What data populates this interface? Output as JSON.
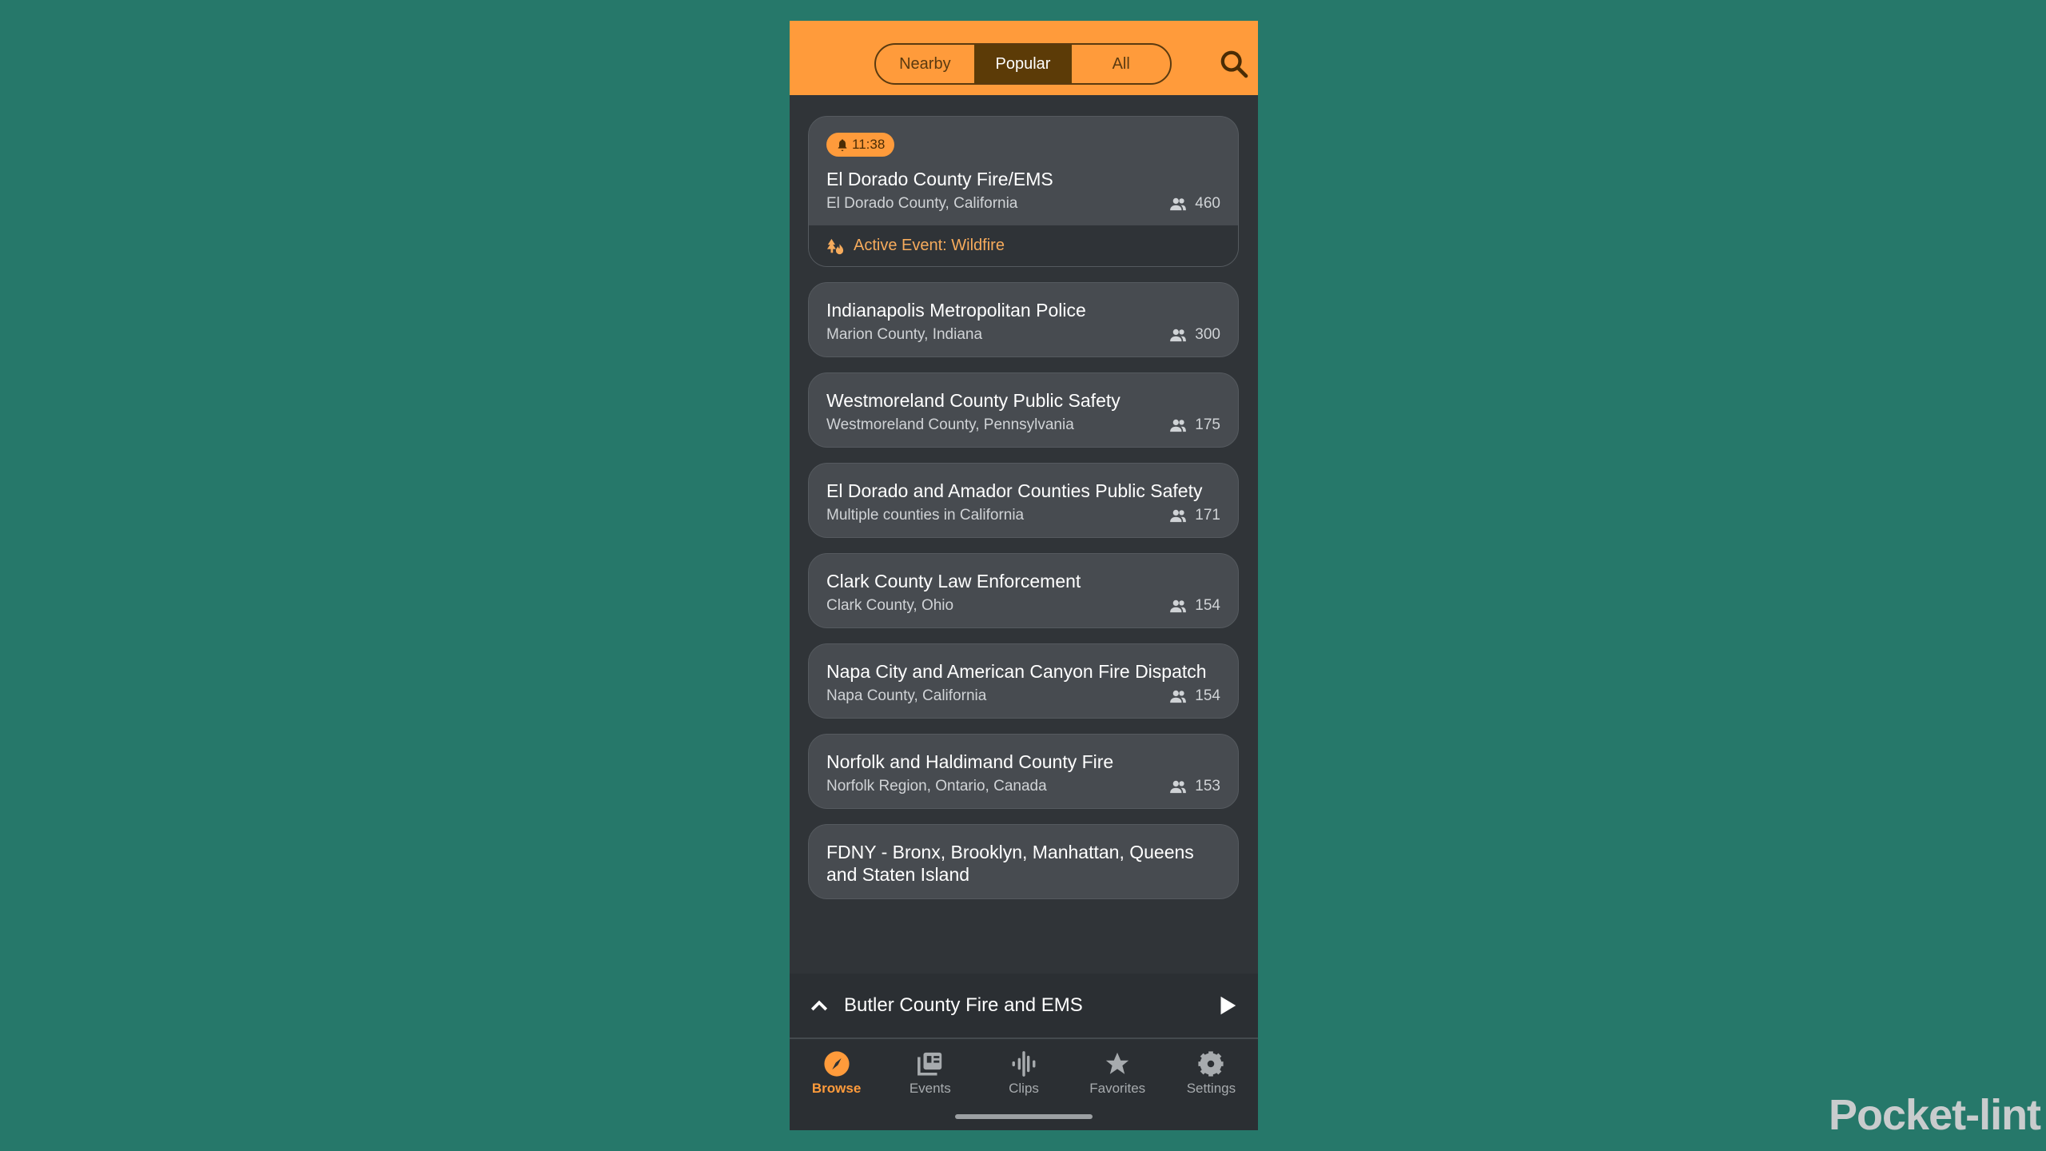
{
  "header": {
    "tabs": [
      {
        "label": "Nearby",
        "active": false
      },
      {
        "label": "Popular",
        "active": true
      },
      {
        "label": "All",
        "active": false
      }
    ],
    "search_icon": "search-icon"
  },
  "feeds": [
    {
      "badge": "11:38",
      "title": "El Dorado County Fire/EMS",
      "location": "El Dorado County, California",
      "listeners": "460",
      "event": "Active Event: Wildfire"
    },
    {
      "title": "Indianapolis Metropolitan Police",
      "location": "Marion County, Indiana",
      "listeners": "300"
    },
    {
      "title": "Westmoreland County Public Safety",
      "location": "Westmoreland County, Pennsylvania",
      "listeners": "175"
    },
    {
      "title": "El Dorado and Amador Counties Public Safety",
      "location": "Multiple counties in California",
      "listeners": "171"
    },
    {
      "title": "Clark County Law Enforcement",
      "location": "Clark County, Ohio",
      "listeners": "154"
    },
    {
      "title": "Napa City and American Canyon Fire Dispatch",
      "location": "Napa County, California",
      "listeners": "154"
    },
    {
      "title": "Norfolk and Haldimand County Fire",
      "location": "Norfolk Region, Ontario, Canada",
      "listeners": "153"
    },
    {
      "title": "FDNY - Bronx, Brooklyn, Manhattan, Queens and Staten Island"
    }
  ],
  "player": {
    "title": "Butler County Fire and EMS"
  },
  "nav": [
    {
      "label": "Browse",
      "icon": "compass-icon",
      "active": true
    },
    {
      "label": "Events",
      "icon": "events-icon"
    },
    {
      "label": "Clips",
      "icon": "audio-wave-icon"
    },
    {
      "label": "Favorites",
      "icon": "star-icon"
    },
    {
      "label": "Settings",
      "icon": "gear-icon"
    }
  ],
  "colors": {
    "accent": "#ff9b3b",
    "background": "#26786a",
    "card": "#474b50"
  },
  "watermark": "Pocket-lint"
}
